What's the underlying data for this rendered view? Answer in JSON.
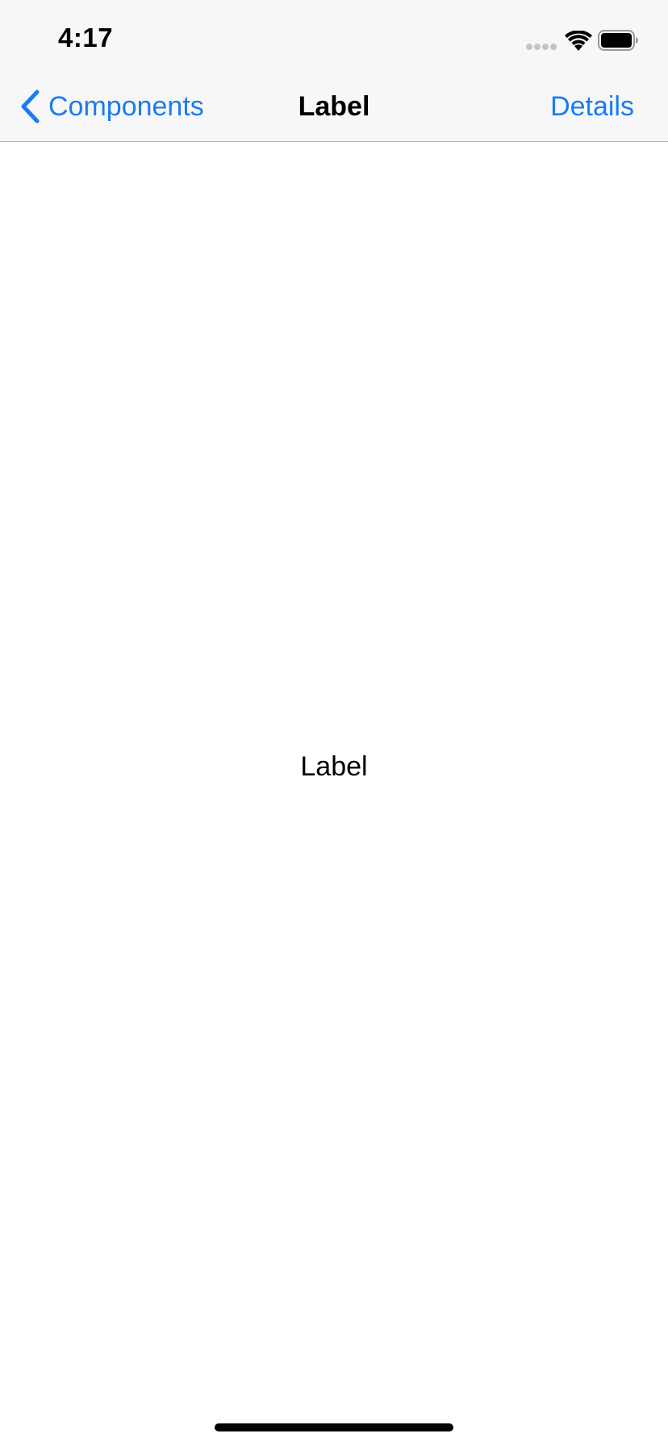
{
  "status_bar": {
    "time": "4:17"
  },
  "nav_bar": {
    "back_label": "Components",
    "title": "Label",
    "right_button_label": "Details"
  },
  "content": {
    "label_text": "Label"
  },
  "colors": {
    "accent": "#1a7cef",
    "nav_background": "#f7f7f7",
    "separator": "#b2b2b2",
    "text": "#000000"
  },
  "icons": {
    "back": "chevron-left-icon",
    "signal": "cellular-signal-icon",
    "wifi": "wifi-icon",
    "battery": "battery-icon"
  }
}
